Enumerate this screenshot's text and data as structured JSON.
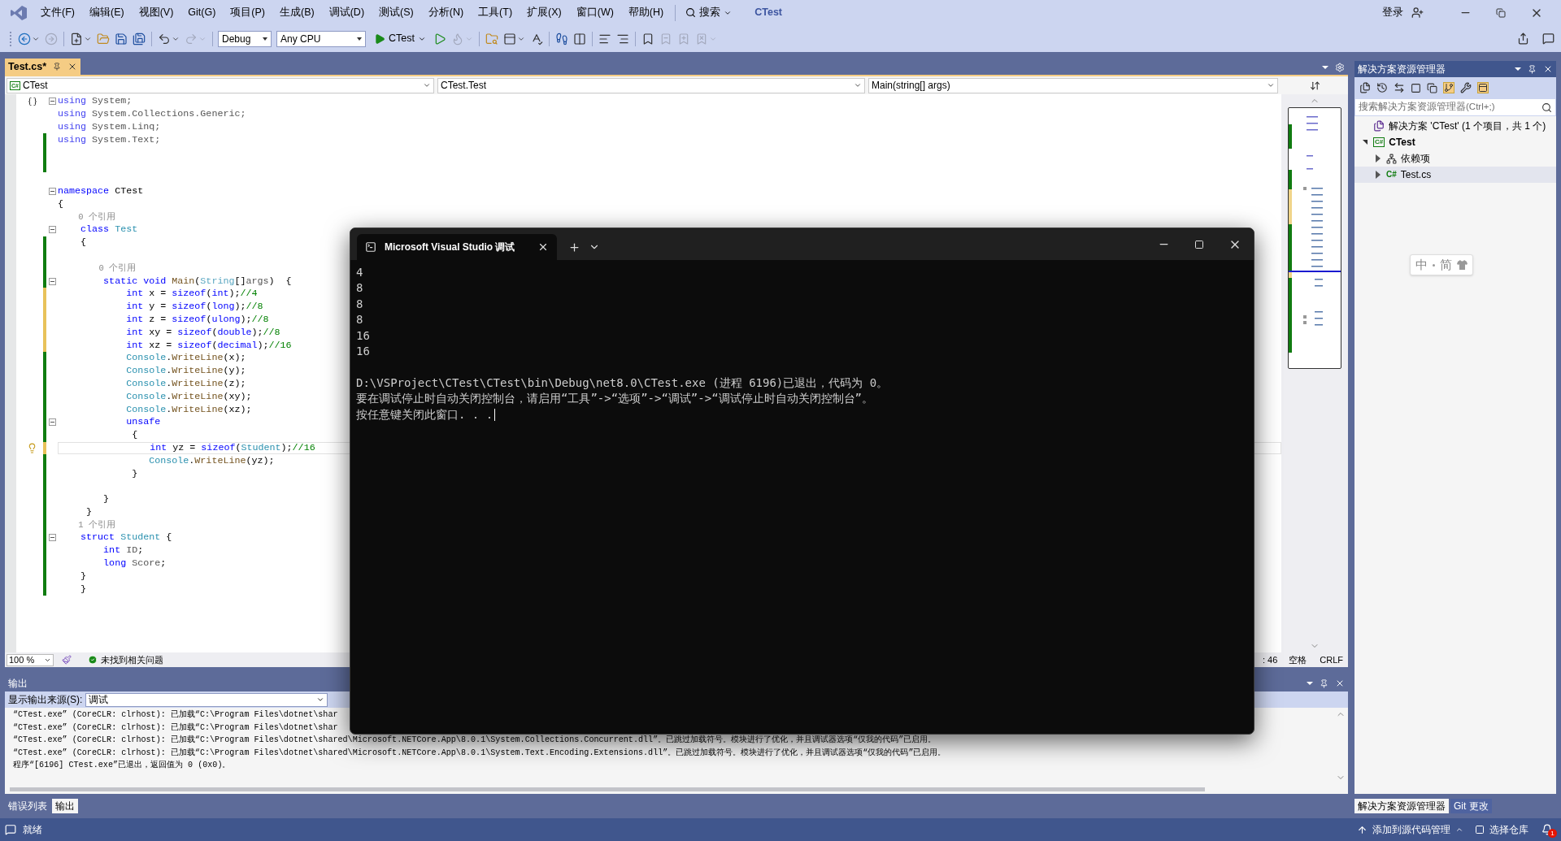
{
  "menu_bar": {
    "items": [
      "文件(F)",
      "编辑(E)",
      "视图(V)",
      "Git(G)",
      "项目(P)",
      "生成(B)",
      "调试(D)",
      "测试(S)",
      "分析(N)",
      "工具(T)",
      "扩展(X)",
      "窗口(W)",
      "帮助(H)"
    ],
    "search": "搜索",
    "solution_name": "CTest",
    "sign_in": "登录"
  },
  "toolbar": {
    "configuration": "Debug",
    "platform": "Any CPU",
    "start_target": "CTest",
    "left_groups": [
      [
        {
          "kind": "back",
          "disabled": false
        },
        {
          "kind": "forward",
          "disabled": true
        }
      ],
      [
        {
          "kind": "new_item",
          "disabled": false
        },
        {
          "kind": "open",
          "disabled": false
        },
        {
          "kind": "save",
          "disabled": false
        },
        {
          "kind": "save_all",
          "disabled": false
        }
      ],
      [
        {
          "kind": "undo",
          "disabled": false
        },
        {
          "kind": "redo",
          "disabled": true
        }
      ]
    ],
    "right_groups": [
      [
        {
          "kind": "run_without_debugging",
          "disabled": false
        },
        {
          "kind": "hot_reload",
          "disabled": true
        }
      ],
      [
        {
          "kind": "find_files",
          "disabled": false
        },
        {
          "kind": "window_layout",
          "disabled": false
        },
        {
          "kind": "spell_check",
          "disabled": false
        }
      ],
      [
        {
          "kind": "step",
          "disabled": false
        },
        {
          "kind": "columns",
          "disabled": false
        }
      ],
      [
        {
          "kind": "indent",
          "disabled": false
        },
        {
          "kind": "outdent",
          "disabled": false
        }
      ],
      [
        {
          "kind": "bookmark",
          "disabled": false
        },
        {
          "kind": "bookmark_previous",
          "disabled": true
        },
        {
          "kind": "bookmark_next",
          "disabled": true
        },
        {
          "kind": "bookmark_clear",
          "disabled": true
        }
      ]
    ]
  },
  "editor_tabs": [
    {
      "label": "Test.cs*",
      "selected": true
    }
  ],
  "nav_bar": {
    "project_badge": "C#",
    "project": "CTest",
    "type": "CTest.Test",
    "member": "Main(string[] args)"
  },
  "code_lines": [
    {
      "kind": "code",
      "fold": true,
      "current": false,
      "segments": [
        {
          "text": "using",
          "kind": "dim_kw"
        },
        {
          "text": " System;",
          "kind": "dim"
        }
      ]
    },
    {
      "kind": "code",
      "fold": false,
      "current": false,
      "segments": [
        {
          "text": "using",
          "kind": "dim_kw"
        },
        {
          "text": " System.Collections.Generic;",
          "kind": "dim"
        }
      ]
    },
    {
      "kind": "code",
      "fold": false,
      "current": false,
      "segments": [
        {
          "text": "using",
          "kind": "dim_kw"
        },
        {
          "text": " System.Linq;",
          "kind": "dim"
        }
      ]
    },
    {
      "kind": "code",
      "color": "#107c10",
      "fold": false,
      "current": false,
      "segments": [
        {
          "text": "using",
          "kind": "dim_kw"
        },
        {
          "text": " System.Text;",
          "kind": "dim"
        }
      ]
    },
    {
      "kind": "blank",
      "color": "#107c10",
      "fold": false,
      "current": false
    },
    {
      "kind": "blank",
      "color": "#107c10",
      "fold": false,
      "current": false
    },
    {
      "kind": "blank",
      "fold": false,
      "current": false
    },
    {
      "kind": "code",
      "fold": true,
      "current": false,
      "segments": [
        {
          "text": "namespace",
          "kind": "kw"
        },
        {
          "text": " CTest",
          "kind": "plain"
        }
      ]
    },
    {
      "kind": "code",
      "fold": false,
      "current": false,
      "segments": [
        {
          "text": "{",
          "kind": "plain"
        }
      ]
    },
    {
      "kind": "lens",
      "fold": false,
      "current": false,
      "text": "    0 个引用"
    },
    {
      "kind": "code",
      "fold": true,
      "current": false,
      "segments": [
        {
          "text": "    class",
          "kind": "kw"
        },
        {
          "text": " Test",
          "kind": "type"
        }
      ]
    },
    {
      "kind": "code",
      "color": "#107c10",
      "fold": false,
      "current": false,
      "segments": [
        {
          "text": "    {",
          "kind": "plain"
        }
      ]
    },
    {
      "kind": "blank",
      "color": "#107c10",
      "fold": false,
      "current": false
    },
    {
      "kind": "lens",
      "color": "#107c10",
      "fold": false,
      "current": false,
      "text": "        0 个引用"
    },
    {
      "kind": "code",
      "color": "#107c10",
      "fold": true,
      "current": false,
      "segments": [
        {
          "text": "        static void",
          "kind": "kw"
        },
        {
          "text": " Main",
          "kind": "method"
        },
        {
          "text": "(",
          "kind": "plain"
        },
        {
          "text": "String",
          "kind": "dim_type"
        },
        {
          "text": "[]",
          "kind": "plain"
        },
        {
          "text": "args",
          "kind": "dim"
        },
        {
          "text": ")  {",
          "kind": "plain"
        }
      ]
    },
    {
      "kind": "code",
      "color": "#e8c25a",
      "fold": false,
      "current": false,
      "segments": [
        {
          "text": "            int",
          "kind": "kw"
        },
        {
          "text": " x = ",
          "kind": "plain"
        },
        {
          "text": "sizeof",
          "kind": "kw"
        },
        {
          "text": "(",
          "kind": "plain"
        },
        {
          "text": "int",
          "kind": "kw"
        },
        {
          "text": ");",
          "kind": "plain"
        },
        {
          "text": "//4",
          "kind": "comment"
        }
      ]
    },
    {
      "kind": "code",
      "color": "#e8c25a",
      "fold": false,
      "current": false,
      "segments": [
        {
          "text": "            int",
          "kind": "kw"
        },
        {
          "text": " y = ",
          "kind": "plain"
        },
        {
          "text": "sizeof",
          "kind": "kw"
        },
        {
          "text": "(",
          "kind": "plain"
        },
        {
          "text": "long",
          "kind": "kw"
        },
        {
          "text": ");",
          "kind": "plain"
        },
        {
          "text": "//8",
          "kind": "comment"
        }
      ]
    },
    {
      "kind": "code",
      "color": "#e8c25a",
      "fold": false,
      "current": false,
      "segments": [
        {
          "text": "            int",
          "kind": "kw"
        },
        {
          "text": " z = ",
          "kind": "plain"
        },
        {
          "text": "sizeof",
          "kind": "kw"
        },
        {
          "text": "(",
          "kind": "plain"
        },
        {
          "text": "ulong",
          "kind": "kw"
        },
        {
          "text": ");",
          "kind": "plain"
        },
        {
          "text": "//8",
          "kind": "comment"
        }
      ]
    },
    {
      "kind": "code",
      "color": "#e8c25a",
      "fold": false,
      "current": false,
      "segments": [
        {
          "text": "            int",
          "kind": "kw"
        },
        {
          "text": " xy = ",
          "kind": "plain"
        },
        {
          "text": "sizeof",
          "kind": "kw"
        },
        {
          "text": "(",
          "kind": "plain"
        },
        {
          "text": "double",
          "kind": "kw"
        },
        {
          "text": ");",
          "kind": "plain"
        },
        {
          "text": "//8",
          "kind": "comment"
        }
      ]
    },
    {
      "kind": "code",
      "color": "#e8c25a",
      "fold": false,
      "current": false,
      "segments": [
        {
          "text": "            int",
          "kind": "kw"
        },
        {
          "text": " xz = ",
          "kind": "plain"
        },
        {
          "text": "sizeof",
          "kind": "kw"
        },
        {
          "text": "(",
          "kind": "plain"
        },
        {
          "text": "decimal",
          "kind": "kw"
        },
        {
          "text": ");",
          "kind": "plain"
        },
        {
          "text": "//16",
          "kind": "comment"
        }
      ]
    },
    {
      "kind": "code",
      "color": "#107c10",
      "fold": false,
      "current": false,
      "segments": [
        {
          "text": "            Console",
          "kind": "type"
        },
        {
          "text": ".",
          "kind": "plain"
        },
        {
          "text": "WriteLine",
          "kind": "method"
        },
        {
          "text": "(x);",
          "kind": "plain"
        }
      ]
    },
    {
      "kind": "code",
      "color": "#107c10",
      "fold": false,
      "current": false,
      "segments": [
        {
          "text": "            Console",
          "kind": "type"
        },
        {
          "text": ".",
          "kind": "plain"
        },
        {
          "text": "WriteLine",
          "kind": "method"
        },
        {
          "text": "(y);",
          "kind": "plain"
        }
      ]
    },
    {
      "kind": "code",
      "color": "#107c10",
      "fold": false,
      "current": false,
      "segments": [
        {
          "text": "            Console",
          "kind": "type"
        },
        {
          "text": ".",
          "kind": "plain"
        },
        {
          "text": "WriteLine",
          "kind": "method"
        },
        {
          "text": "(z);",
          "kind": "plain"
        }
      ]
    },
    {
      "kind": "code",
      "color": "#107c10",
      "fold": false,
      "current": false,
      "segments": [
        {
          "text": "            Console",
          "kind": "type"
        },
        {
          "text": ".",
          "kind": "plain"
        },
        {
          "text": "WriteLine",
          "kind": "method"
        },
        {
          "text": "(xy);",
          "kind": "plain"
        }
      ]
    },
    {
      "kind": "code",
      "color": "#107c10",
      "fold": false,
      "current": false,
      "segments": [
        {
          "text": "            Console",
          "kind": "type"
        },
        {
          "text": ".",
          "kind": "plain"
        },
        {
          "text": "WriteLine",
          "kind": "method"
        },
        {
          "text": "(xz);",
          "kind": "plain"
        }
      ]
    },
    {
      "kind": "code",
      "color": "#107c10",
      "fold": true,
      "current": false,
      "segments": [
        {
          "text": "            unsafe",
          "kind": "kw"
        }
      ]
    },
    {
      "kind": "code",
      "color": "#107c10",
      "fold": false,
      "current": false,
      "segments": [
        {
          "text": "             {",
          "kind": "plain"
        }
      ]
    },
    {
      "kind": "code",
      "color": "#e8c25a",
      "fold": false,
      "current": true,
      "segments": [
        {
          "text": "                int",
          "kind": "kw"
        },
        {
          "text": " yz = ",
          "kind": "plain"
        },
        {
          "text": "sizeof",
          "kind": "kw"
        },
        {
          "text": "(",
          "kind": "plain"
        },
        {
          "text": "Student",
          "kind": "type"
        },
        {
          "text": ");",
          "kind": "plain"
        },
        {
          "text": "//16",
          "kind": "comment"
        }
      ]
    },
    {
      "kind": "code",
      "color": "#107c10",
      "fold": false,
      "current": false,
      "segments": [
        {
          "text": "                Console",
          "kind": "type"
        },
        {
          "text": ".",
          "kind": "plain"
        },
        {
          "text": "WriteLine",
          "kind": "method"
        },
        {
          "text": "(yz);",
          "kind": "plain"
        }
      ]
    },
    {
      "kind": "code",
      "color": "#107c10",
      "fold": false,
      "current": false,
      "segments": [
        {
          "text": "             }",
          "kind": "plain"
        }
      ]
    },
    {
      "kind": "blank",
      "color": "#107c10",
      "fold": false,
      "current": false
    },
    {
      "kind": "code",
      "color": "#107c10",
      "fold": false,
      "current": false,
      "segments": [
        {
          "text": "        }",
          "kind": "plain"
        }
      ]
    },
    {
      "kind": "code",
      "color": "#107c10",
      "fold": false,
      "current": false,
      "segments": [
        {
          "text": "     }",
          "kind": "plain"
        }
      ]
    },
    {
      "kind": "lens",
      "color": "#107c10",
      "fold": false,
      "current": false,
      "text": "    1 个引用"
    },
    {
      "kind": "code",
      "color": "#107c10",
      "fold": true,
      "current": false,
      "segments": [
        {
          "text": "    struct",
          "kind": "kw"
        },
        {
          "text": " Student",
          "kind": "type"
        },
        {
          "text": " {",
          "kind": "plain"
        }
      ]
    },
    {
      "kind": "code",
      "color": "#107c10",
      "fold": false,
      "current": false,
      "segments": [
        {
          "text": "        int",
          "kind": "kw"
        },
        {
          "text": " ID",
          "kind": "dim"
        },
        {
          "text": ";",
          "kind": "plain"
        }
      ]
    },
    {
      "kind": "code",
      "color": "#107c10",
      "fold": false,
      "current": false,
      "segments": [
        {
          "text": "        long",
          "kind": "kw"
        },
        {
          "text": " Score",
          "kind": "dim"
        },
        {
          "text": ";",
          "kind": "plain"
        }
      ]
    },
    {
      "kind": "code",
      "color": "#107c10",
      "fold": false,
      "current": false,
      "segments": [
        {
          "text": "    }",
          "kind": "plain"
        }
      ]
    },
    {
      "kind": "code",
      "color": "#107c10",
      "fold": false,
      "current": false,
      "segments": [
        {
          "text": "    }",
          "kind": "plain"
        }
      ]
    }
  ],
  "editor_status": {
    "zoom": "100 %",
    "issues": "未找到相关问题",
    "line": ": 46",
    "indent": "空格",
    "line_ending": "CRLF"
  },
  "output_panel": {
    "title": "输出",
    "source_label": "显示输出来源(S):",
    "source": "调试",
    "lines": [
      "“CTest.exe” (CoreCLR: clrhost): 已加载“C:\\Program Files\\dotnet\\shar",
      "“CTest.exe” (CoreCLR: clrhost): 已加载“C:\\Program Files\\dotnet\\shar",
      "“CTest.exe” (CoreCLR: clrhost): 已加载“C:\\Program Files\\dotnet\\shared\\Microsoft.NETCore.App\\8.0.1\\System.Collections.Concurrent.dll”。已跳过加载符号。模块进行了优化，并且调试器选项“仅我的代码”已启用。",
      "“CTest.exe” (CoreCLR: clrhost): 已加载“C:\\Program Files\\dotnet\\shared\\Microsoft.NETCore.App\\8.0.1\\System.Text.Encoding.Extensions.dll”。已跳过加载符号。模块进行了优化，并且调试器选项“仅我的代码”已启用。",
      "程序“[6196] CTest.exe”已退出，返回值为 0 (0x0)。"
    ]
  },
  "bottom_tabs": [
    {
      "label": "错误列表",
      "selected": false
    },
    {
      "label": "输出",
      "selected": true
    }
  ],
  "solution_explorer": {
    "title": "解决方案资源管理器",
    "search_placeholder": "搜索解决方案资源管理器(Ctrl+;)",
    "tree": [
      {
        "label": "解决方案 'CTest' (1 个项目，共 1 个)",
        "kind": "solution",
        "selected": false,
        "children": [
          {
            "label": "CTest",
            "kind": "project",
            "badge": "C#",
            "expanded": true,
            "selected": false,
            "children": [
              {
                "label": "依赖项",
                "kind": "dependencies",
                "expanded": false,
                "selected": false
              },
              {
                "label": "Test.cs",
                "kind": "file",
                "badge": "C#",
                "expanded": false,
                "selected": true
              }
            ]
          }
        ]
      }
    ],
    "tabs": [
      {
        "label": "解决方案资源管理器",
        "selected": true
      },
      {
        "label": "Git 更改",
        "selected": false
      }
    ]
  },
  "ime": {
    "mode": "中",
    "script": "简"
  },
  "status_bar": {
    "message": "就绪",
    "source_control": "添加到源代码管理",
    "repository": "选择仓库",
    "notifications": "1"
  },
  "terminal": {
    "tab_title": "Microsoft Visual Studio 调试",
    "output": [
      "4",
      "8",
      "8",
      "8",
      "16",
      "16"
    ],
    "messages": [
      "D:\\VSProject\\CTest\\CTest\\bin\\Debug\\net8.0\\CTest.exe (进程 6196)已退出，代码为 0。",
      "要在调试停止时自动关闭控制台，请启用“工具”->“选项”->“调试”->“调试停止时自动关闭控制台”。",
      "按任意键关闭此窗口. . ."
    ]
  }
}
